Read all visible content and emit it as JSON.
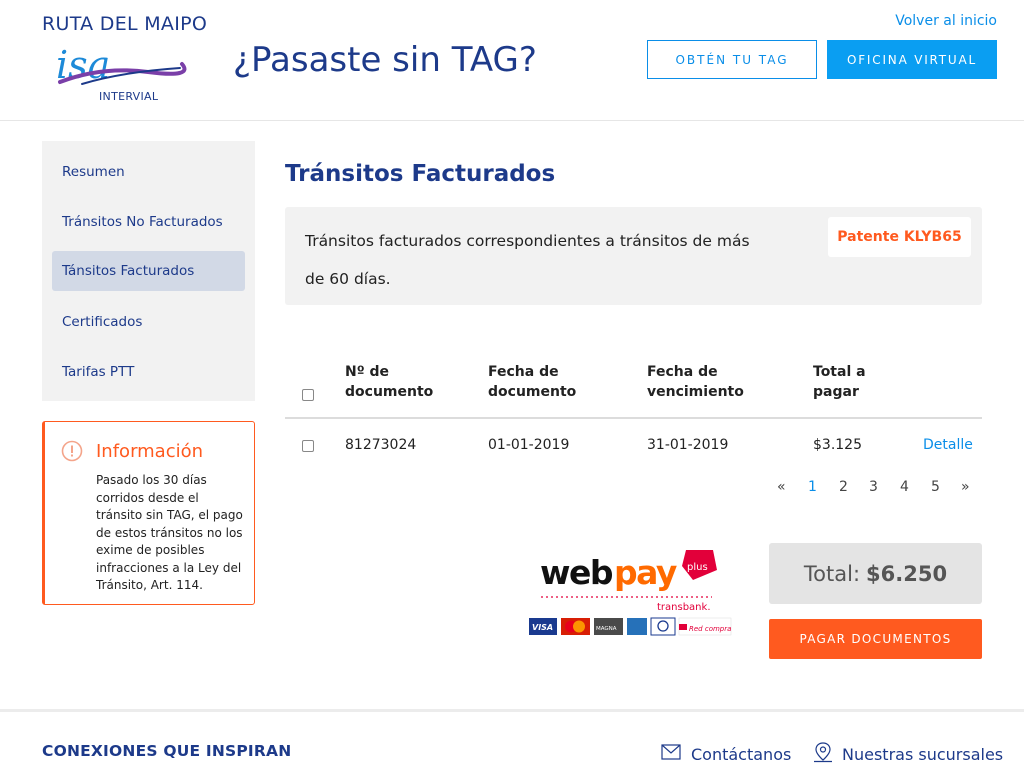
{
  "header": {
    "brand_name": "RUTA DEL MAIPO",
    "logo_word": "isa",
    "logo_sub": "INTERVIAL",
    "title": "¿Pasaste sin TAG?",
    "back_link": "Volver al inicio",
    "get_tag_label": "OBTÉN TU TAG",
    "virtual_office_label": "OFICINA VIRTUAL"
  },
  "sidebar": {
    "items": [
      {
        "label": "Resumen",
        "active": false
      },
      {
        "label": "Tránsitos No Facturados",
        "active": false
      },
      {
        "label": "Tánsitos Facturados",
        "active": true
      },
      {
        "label": "Certificados",
        "active": false
      },
      {
        "label": "Tarifas PTT",
        "active": false
      }
    ]
  },
  "info": {
    "icon": "alert-circle-icon",
    "title": "Información",
    "text": "Pasado los 30 días corridos desde el tránsito sin TAG, el pago de estos tránsitos no los exime de posibles infracciones a la Ley del Tránsito, Art. 114."
  },
  "main": {
    "title": "Tránsitos Facturados",
    "notice": "Tránsitos facturados correspondientes a tránsitos de más de 60 días.",
    "plate": "Patente KLYB65"
  },
  "table": {
    "headers": [
      "Nº de documento",
      "Fecha de documento",
      "Fecha de vencimiento",
      "Total a pagar"
    ],
    "rows": [
      {
        "document": "81273024",
        "date": "01-01-2019",
        "due": "31-01-2019",
        "total": "$3.125",
        "action": "Detalle"
      }
    ]
  },
  "pagination": {
    "prev": "«",
    "pages": [
      "1",
      "2",
      "3",
      "4",
      "5"
    ],
    "current": "1",
    "next": "»"
  },
  "payment": {
    "webpay_word_1": "web",
    "webpay_word_2": "pay",
    "webpay_badge": "plus",
    "transbank": "transbank.",
    "cards": [
      "VISA",
      "MasterCard",
      "MAGNA",
      "AMEX",
      "Diners",
      "Red compra"
    ],
    "total_label": "Total:",
    "total_value": "$6.250",
    "pay_button": "PAGAR DOCUMENTOS"
  },
  "footer": {
    "tagline": "CONEXIONES QUE INSPIRAN",
    "contact_label": "Contáctanos",
    "contact_icon": "envelope-icon",
    "branches_label": "Nuestras sucursales",
    "branches_icon": "location-pin-icon"
  },
  "colors": {
    "brand_blue": "#1d3a8a",
    "link_blue": "#0a8ee8",
    "accent_orange": "#ff5a1f",
    "panel_gray": "#f2f2f2"
  }
}
